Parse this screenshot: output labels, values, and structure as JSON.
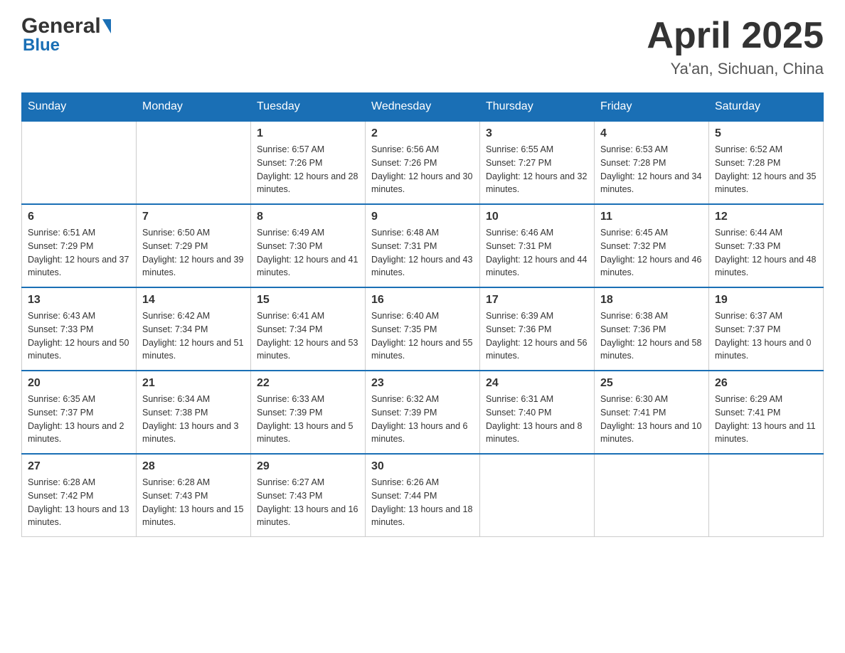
{
  "header": {
    "logo_general": "General",
    "logo_blue": "Blue",
    "title": "April 2025",
    "subtitle": "Ya'an, Sichuan, China"
  },
  "weekdays": [
    "Sunday",
    "Monday",
    "Tuesday",
    "Wednesday",
    "Thursday",
    "Friday",
    "Saturday"
  ],
  "weeks": [
    {
      "days": [
        {
          "number": "",
          "sunrise": "",
          "sunset": "",
          "daylight": ""
        },
        {
          "number": "",
          "sunrise": "",
          "sunset": "",
          "daylight": ""
        },
        {
          "number": "1",
          "sunrise": "Sunrise: 6:57 AM",
          "sunset": "Sunset: 7:26 PM",
          "daylight": "Daylight: 12 hours and 28 minutes."
        },
        {
          "number": "2",
          "sunrise": "Sunrise: 6:56 AM",
          "sunset": "Sunset: 7:26 PM",
          "daylight": "Daylight: 12 hours and 30 minutes."
        },
        {
          "number": "3",
          "sunrise": "Sunrise: 6:55 AM",
          "sunset": "Sunset: 7:27 PM",
          "daylight": "Daylight: 12 hours and 32 minutes."
        },
        {
          "number": "4",
          "sunrise": "Sunrise: 6:53 AM",
          "sunset": "Sunset: 7:28 PM",
          "daylight": "Daylight: 12 hours and 34 minutes."
        },
        {
          "number": "5",
          "sunrise": "Sunrise: 6:52 AM",
          "sunset": "Sunset: 7:28 PM",
          "daylight": "Daylight: 12 hours and 35 minutes."
        }
      ]
    },
    {
      "days": [
        {
          "number": "6",
          "sunrise": "Sunrise: 6:51 AM",
          "sunset": "Sunset: 7:29 PM",
          "daylight": "Daylight: 12 hours and 37 minutes."
        },
        {
          "number": "7",
          "sunrise": "Sunrise: 6:50 AM",
          "sunset": "Sunset: 7:29 PM",
          "daylight": "Daylight: 12 hours and 39 minutes."
        },
        {
          "number": "8",
          "sunrise": "Sunrise: 6:49 AM",
          "sunset": "Sunset: 7:30 PM",
          "daylight": "Daylight: 12 hours and 41 minutes."
        },
        {
          "number": "9",
          "sunrise": "Sunrise: 6:48 AM",
          "sunset": "Sunset: 7:31 PM",
          "daylight": "Daylight: 12 hours and 43 minutes."
        },
        {
          "number": "10",
          "sunrise": "Sunrise: 6:46 AM",
          "sunset": "Sunset: 7:31 PM",
          "daylight": "Daylight: 12 hours and 44 minutes."
        },
        {
          "number": "11",
          "sunrise": "Sunrise: 6:45 AM",
          "sunset": "Sunset: 7:32 PM",
          "daylight": "Daylight: 12 hours and 46 minutes."
        },
        {
          "number": "12",
          "sunrise": "Sunrise: 6:44 AM",
          "sunset": "Sunset: 7:33 PM",
          "daylight": "Daylight: 12 hours and 48 minutes."
        }
      ]
    },
    {
      "days": [
        {
          "number": "13",
          "sunrise": "Sunrise: 6:43 AM",
          "sunset": "Sunset: 7:33 PM",
          "daylight": "Daylight: 12 hours and 50 minutes."
        },
        {
          "number": "14",
          "sunrise": "Sunrise: 6:42 AM",
          "sunset": "Sunset: 7:34 PM",
          "daylight": "Daylight: 12 hours and 51 minutes."
        },
        {
          "number": "15",
          "sunrise": "Sunrise: 6:41 AM",
          "sunset": "Sunset: 7:34 PM",
          "daylight": "Daylight: 12 hours and 53 minutes."
        },
        {
          "number": "16",
          "sunrise": "Sunrise: 6:40 AM",
          "sunset": "Sunset: 7:35 PM",
          "daylight": "Daylight: 12 hours and 55 minutes."
        },
        {
          "number": "17",
          "sunrise": "Sunrise: 6:39 AM",
          "sunset": "Sunset: 7:36 PM",
          "daylight": "Daylight: 12 hours and 56 minutes."
        },
        {
          "number": "18",
          "sunrise": "Sunrise: 6:38 AM",
          "sunset": "Sunset: 7:36 PM",
          "daylight": "Daylight: 12 hours and 58 minutes."
        },
        {
          "number": "19",
          "sunrise": "Sunrise: 6:37 AM",
          "sunset": "Sunset: 7:37 PM",
          "daylight": "Daylight: 13 hours and 0 minutes."
        }
      ]
    },
    {
      "days": [
        {
          "number": "20",
          "sunrise": "Sunrise: 6:35 AM",
          "sunset": "Sunset: 7:37 PM",
          "daylight": "Daylight: 13 hours and 2 minutes."
        },
        {
          "number": "21",
          "sunrise": "Sunrise: 6:34 AM",
          "sunset": "Sunset: 7:38 PM",
          "daylight": "Daylight: 13 hours and 3 minutes."
        },
        {
          "number": "22",
          "sunrise": "Sunrise: 6:33 AM",
          "sunset": "Sunset: 7:39 PM",
          "daylight": "Daylight: 13 hours and 5 minutes."
        },
        {
          "number": "23",
          "sunrise": "Sunrise: 6:32 AM",
          "sunset": "Sunset: 7:39 PM",
          "daylight": "Daylight: 13 hours and 6 minutes."
        },
        {
          "number": "24",
          "sunrise": "Sunrise: 6:31 AM",
          "sunset": "Sunset: 7:40 PM",
          "daylight": "Daylight: 13 hours and 8 minutes."
        },
        {
          "number": "25",
          "sunrise": "Sunrise: 6:30 AM",
          "sunset": "Sunset: 7:41 PM",
          "daylight": "Daylight: 13 hours and 10 minutes."
        },
        {
          "number": "26",
          "sunrise": "Sunrise: 6:29 AM",
          "sunset": "Sunset: 7:41 PM",
          "daylight": "Daylight: 13 hours and 11 minutes."
        }
      ]
    },
    {
      "days": [
        {
          "number": "27",
          "sunrise": "Sunrise: 6:28 AM",
          "sunset": "Sunset: 7:42 PM",
          "daylight": "Daylight: 13 hours and 13 minutes."
        },
        {
          "number": "28",
          "sunrise": "Sunrise: 6:28 AM",
          "sunset": "Sunset: 7:43 PM",
          "daylight": "Daylight: 13 hours and 15 minutes."
        },
        {
          "number": "29",
          "sunrise": "Sunrise: 6:27 AM",
          "sunset": "Sunset: 7:43 PM",
          "daylight": "Daylight: 13 hours and 16 minutes."
        },
        {
          "number": "30",
          "sunrise": "Sunrise: 6:26 AM",
          "sunset": "Sunset: 7:44 PM",
          "daylight": "Daylight: 13 hours and 18 minutes."
        },
        {
          "number": "",
          "sunrise": "",
          "sunset": "",
          "daylight": ""
        },
        {
          "number": "",
          "sunrise": "",
          "sunset": "",
          "daylight": ""
        },
        {
          "number": "",
          "sunrise": "",
          "sunset": "",
          "daylight": ""
        }
      ]
    }
  ]
}
